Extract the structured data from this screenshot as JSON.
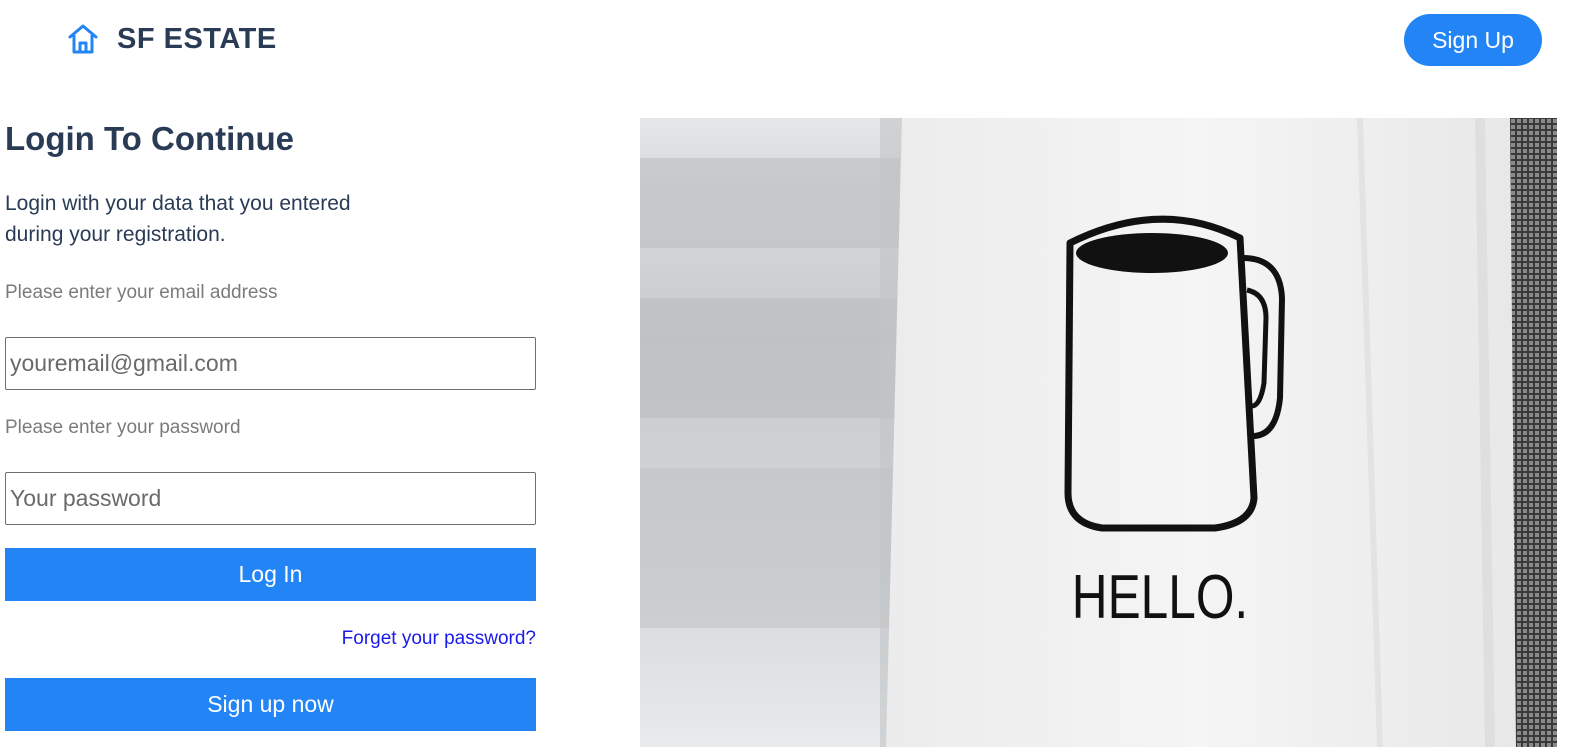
{
  "brand": {
    "name": "SF ESTATE",
    "icon": "home-icon",
    "accent_color": "#2385f5"
  },
  "header": {
    "signup_label": "Sign Up"
  },
  "login": {
    "title": "Login To Continue",
    "subtitle": "Login with your data that you entered during your registration.",
    "email_label": "Please enter your email address",
    "email_placeholder": "youremail@gmail.com",
    "password_label": "Please enter your password",
    "password_placeholder": "Your password",
    "login_button": "Log In",
    "forgot_link": "Forget your password?",
    "signup_now_button": "Sign up now"
  },
  "hero": {
    "towel_text": "HELLO."
  }
}
